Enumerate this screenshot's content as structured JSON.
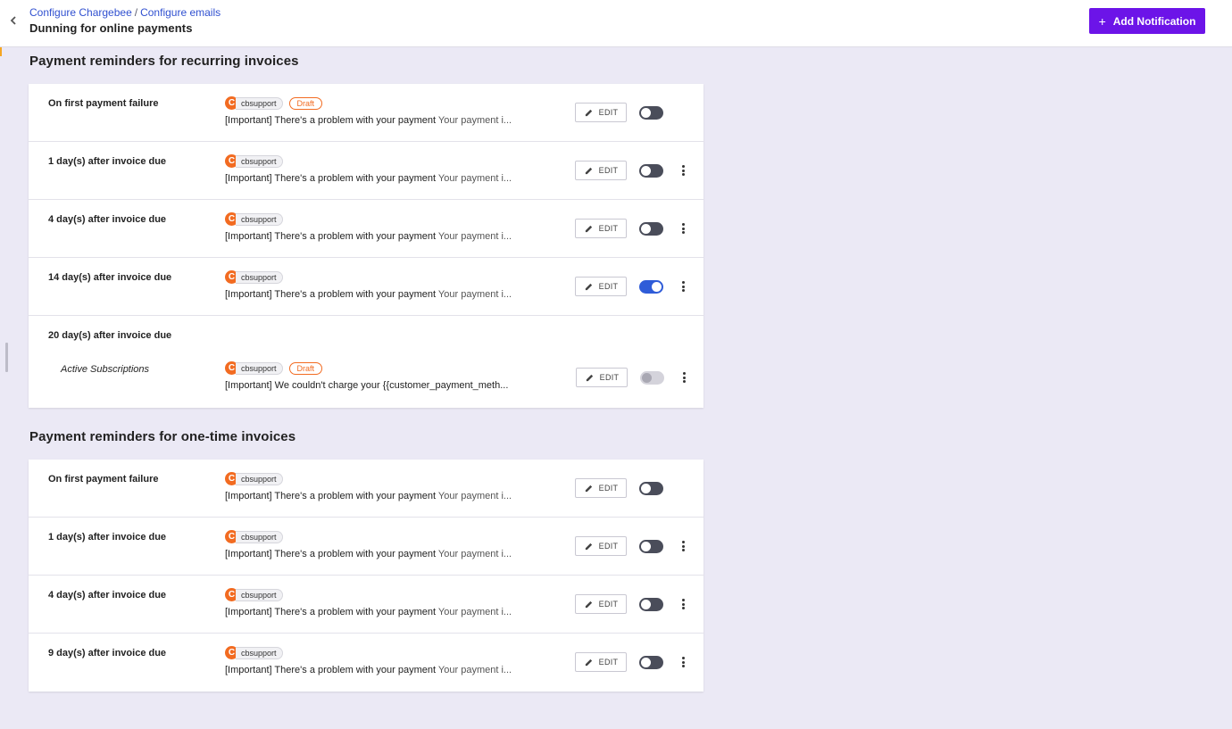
{
  "header": {
    "breadcrumb": [
      "Configure Chargebee",
      "Configure emails"
    ],
    "breadcrumb_separator": "/",
    "title": "Dunning for online payments",
    "add_button_label": "Add Notification",
    "add_button_icon": "plus-icon",
    "back_icon": "chevron-left-icon"
  },
  "colors": {
    "accent": "#6c14e8",
    "avatar": "#f26b21",
    "draft": "#f26b21",
    "toggle_on": "#2f5cd8",
    "background": "#ebe9f5"
  },
  "sections": [
    {
      "title": "Payment reminders for recurring invoices",
      "rows": [
        {
          "name": "On first payment failure",
          "avatar": "C",
          "sender": "cbsupport",
          "badge": "Draft",
          "subject": "[Important] There's a problem with your payment",
          "preview": "Your payment i...",
          "edit": "EDIT",
          "enabled": false,
          "has_menu": false
        },
        {
          "name": "1 day(s) after invoice due",
          "avatar": "C",
          "sender": "cbsupport",
          "subject": "[Important] There's a problem with your payment",
          "preview": "Your payment i...",
          "edit": "EDIT",
          "enabled": false,
          "has_menu": true
        },
        {
          "name": "4 day(s) after invoice due",
          "avatar": "C",
          "sender": "cbsupport",
          "subject": "[Important] There's a problem with your payment",
          "preview": "Your payment i...",
          "edit": "EDIT",
          "enabled": false,
          "has_menu": true
        },
        {
          "name": "14 day(s) after invoice due",
          "avatar": "C",
          "sender": "cbsupport",
          "subject": "[Important] There's a problem with your payment",
          "preview": "Your payment i...",
          "edit": "EDIT",
          "enabled": true,
          "has_menu": true
        },
        {
          "name": "20 day(s) after invoice due",
          "sub_name": "Active Subscriptions",
          "avatar": "C",
          "sender": "cbsupport",
          "badge": "Draft",
          "subject": "[Important] We couldn't charge your {{customer_payment_meth...",
          "preview": "",
          "edit": "EDIT",
          "enabled": false,
          "disabled": true,
          "has_menu": true
        }
      ]
    },
    {
      "title": "Payment reminders for one-time invoices",
      "rows": [
        {
          "name": "On first payment failure",
          "avatar": "C",
          "sender": "cbsupport",
          "subject": "[Important] There's a problem with your payment",
          "preview": "Your payment i...",
          "edit": "EDIT",
          "enabled": false,
          "has_menu": false
        },
        {
          "name": "1 day(s) after invoice due",
          "avatar": "C",
          "sender": "cbsupport",
          "subject": "[Important] There's a problem with your payment",
          "preview": "Your payment i...",
          "edit": "EDIT",
          "enabled": false,
          "has_menu": true
        },
        {
          "name": "4 day(s) after invoice due",
          "avatar": "C",
          "sender": "cbsupport",
          "subject": "[Important] There's a problem with your payment",
          "preview": "Your payment i...",
          "edit": "EDIT",
          "enabled": false,
          "has_menu": true
        },
        {
          "name": "9 day(s) after invoice due",
          "avatar": "C",
          "sender": "cbsupport",
          "subject": "[Important] There's a problem with your payment",
          "preview": "Your payment i...",
          "edit": "EDIT",
          "enabled": false,
          "has_menu": true
        }
      ]
    }
  ]
}
